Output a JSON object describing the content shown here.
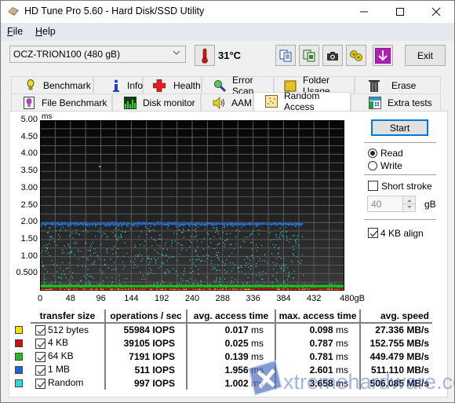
{
  "window": {
    "title": "HD Tune Pro 5.60 - Hard Disk/SSD Utility",
    "controls": [
      "minimize",
      "maximize",
      "close"
    ]
  },
  "menu": {
    "items": [
      {
        "label": "File",
        "mnemonic": "F",
        "rest": "ile"
      },
      {
        "label": "Help",
        "mnemonic": "H",
        "rest": "elp"
      }
    ]
  },
  "toolbar": {
    "drive": "OCZ-TRION100 (480 gB)",
    "temperature": "31°C",
    "buttons": [
      "copy-text",
      "copy-screenshot",
      "save-screenshot",
      "options",
      "download"
    ],
    "exit_label": "Exit"
  },
  "tabs": {
    "row1": [
      {
        "label": "Benchmark",
        "icon": "lightbulb-icon"
      },
      {
        "label": "Info",
        "icon": "info-icon"
      },
      {
        "label": "Health",
        "icon": "red-cross-icon"
      },
      {
        "label": "Error Scan",
        "icon": "magnifier-icon"
      },
      {
        "label": "Folder Usage",
        "icon": "folder-icon"
      },
      {
        "label": "Erase",
        "icon": "trash-icon"
      }
    ],
    "row2": [
      {
        "label": "File Benchmark",
        "icon": "file-lightbulb-icon"
      },
      {
        "label": "Disk monitor",
        "icon": "bar-chart-icon"
      },
      {
        "label": "AAM",
        "icon": "speaker-icon"
      },
      {
        "label": "Random Access",
        "icon": "scatter-icon",
        "active": true
      },
      {
        "label": "Extra tests",
        "icon": "calculator-icon"
      }
    ]
  },
  "chart_data": {
    "type": "scatter",
    "title": "",
    "ylabel": "ms",
    "xlabel": "gB",
    "ylim": [
      0,
      5.0
    ],
    "xlim": [
      0,
      480
    ],
    "y_ticks": [
      "5.00",
      "4.50",
      "4.00",
      "3.50",
      "3.00",
      "2.50",
      "2.00",
      "1.50",
      "1.00",
      "0.500"
    ],
    "x_ticks": [
      "0",
      "48",
      "96",
      "144",
      "192",
      "240",
      "288",
      "336",
      "384",
      "432",
      "480gB"
    ],
    "grid": true,
    "series": [
      {
        "name": "512 bytes",
        "color": "#f0e000",
        "avg_ms": 0.017,
        "max_ms": 0.098,
        "x_range_gB": [
          0,
          480
        ]
      },
      {
        "name": "4 KB",
        "color": "#d01010",
        "avg_ms": 0.025,
        "max_ms": 0.787,
        "x_range_gB": [
          0,
          480
        ]
      },
      {
        "name": "64 KB",
        "color": "#20c020",
        "avg_ms": 0.139,
        "max_ms": 0.781,
        "x_range_gB": [
          0,
          480
        ]
      },
      {
        "name": "1 MB",
        "color": "#2070e0",
        "avg_ms": 1.956,
        "max_ms": 2.601,
        "x_range_gB": [
          0,
          415
        ]
      },
      {
        "name": "Random",
        "color": "#30d0d0",
        "avg_ms": 1.002,
        "max_ms": 3.658,
        "x_range_gB": [
          0,
          415
        ]
      }
    ]
  },
  "side": {
    "start_label": "Start",
    "read_label": "Read",
    "write_label": "Write",
    "mode": "read",
    "short_stroke_label": "Short stroke",
    "short_stroke_checked": false,
    "short_stroke_value": "40",
    "short_stroke_unit": "gB",
    "align_label": "4 KB align",
    "align_checked": true
  },
  "results": {
    "headers": [
      "transfer size",
      "operations / sec",
      "avg. access time",
      "max. access time",
      "avg. speed"
    ],
    "rows": [
      {
        "color": "#f0e000",
        "size": "512 bytes",
        "checked": true,
        "ops": "55984",
        "ops_unit": "IOPS",
        "avg": "0.017",
        "avg_unit": "ms",
        "max": "0.098",
        "max_unit": "ms",
        "speed": "27.336 MB/s"
      },
      {
        "color": "#d01010",
        "size": "4 KB",
        "checked": true,
        "ops": "39105",
        "ops_unit": "IOPS",
        "avg": "0.025",
        "avg_unit": "ms",
        "max": "0.787",
        "max_unit": "ms",
        "speed": "152.755 MB/s"
      },
      {
        "color": "#20c020",
        "size": "64 KB",
        "checked": true,
        "ops": "7191",
        "ops_unit": "IOPS",
        "avg": "0.139",
        "avg_unit": "ms",
        "max": "0.781",
        "max_unit": "ms",
        "speed": "449.479 MB/s"
      },
      {
        "color": "#2060d8",
        "size": "1 MB",
        "checked": true,
        "ops": "511",
        "ops_unit": "IOPS",
        "avg": "1.956",
        "avg_unit": "ms",
        "max": "2.601",
        "max_unit": "ms",
        "speed": "511.110 MB/s"
      },
      {
        "color": "#30d8e0",
        "size": "Random",
        "checked": true,
        "ops": "997",
        "ops_unit": "IOPS",
        "avg": "1.002",
        "avg_unit": "ms",
        "max": "3.658",
        "max_unit": "ms",
        "speed": "506.085 MB/s"
      }
    ]
  },
  "watermark": {
    "text": "xtremehardware.com"
  }
}
